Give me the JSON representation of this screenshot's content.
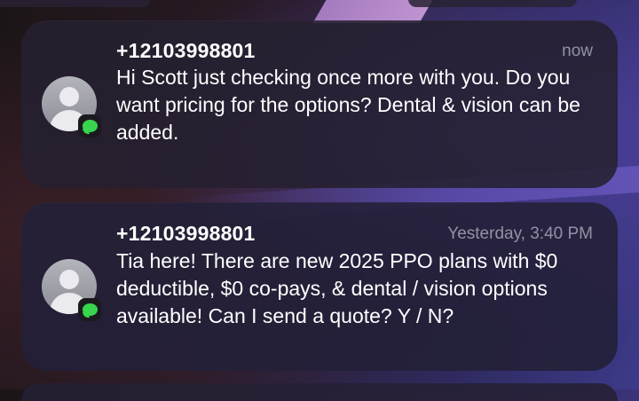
{
  "notifications": [
    {
      "app_icon": "messages-icon",
      "sender": "+12103998801",
      "time": "now",
      "message": "Hi Scott just checking once more with you. Do you want pricing for the options? Dental & vision can be added."
    },
    {
      "app_icon": "messages-icon",
      "sender": "+12103998801",
      "time": "Yesterday, 3:40 PM",
      "message": "Tia here! There are new 2025 PPO plans with $0 deductible, $0 co-pays, & dental / vision options available! Can I send a quote? Y / N?"
    }
  ],
  "colors": {
    "card_background": "#262030",
    "messages_green": "#39d54f",
    "secondary_text": "#8e8e99"
  }
}
